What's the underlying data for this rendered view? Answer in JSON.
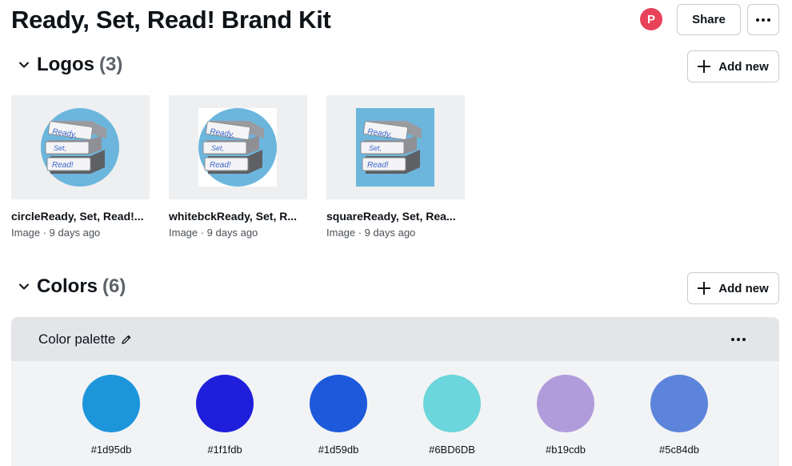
{
  "header": {
    "title": "Ready, Set, Read! Brand Kit",
    "avatar_initial": "P",
    "share_label": "Share"
  },
  "logos": {
    "title": "Logos",
    "count": "(3)",
    "add_label": "Add new",
    "items": [
      {
        "name": "circleReady, Set, Read!...",
        "meta": "Image · 9 days ago",
        "variant": "circle"
      },
      {
        "name": "whitebckReady, Set, R...",
        "meta": "Image · 9 days ago",
        "variant": "white"
      },
      {
        "name": "squareReady, Set, Rea...",
        "meta": "Image · 9 days ago",
        "variant": "square"
      }
    ],
    "logo_text": [
      "Ready,",
      "Set,",
      "Read!"
    ]
  },
  "colors": {
    "title": "Colors",
    "count": "(6)",
    "add_label": "Add new",
    "palette_title": "Color palette",
    "swatches": [
      {
        "hex": "#1d95db",
        "label": "#1d95db"
      },
      {
        "hex": "#1f1fdb",
        "label": "#1f1fdb"
      },
      {
        "hex": "#1d59db",
        "label": "#1d59db"
      },
      {
        "hex": "#6BD6DB",
        "label": "#6BD6DB"
      },
      {
        "hex": "#b19cdb",
        "label": "#b19cdb"
      },
      {
        "hex": "#5c84db",
        "label": "#5c84db"
      }
    ]
  }
}
